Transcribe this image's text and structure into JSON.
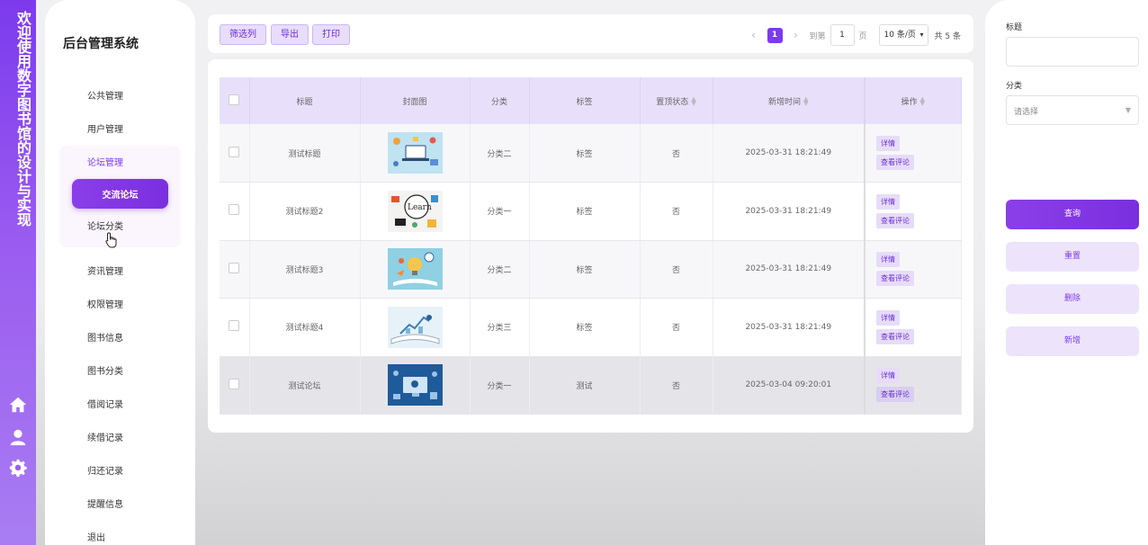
{
  "app": {
    "vertical_title": "欢迎使用数字图书馆的设计与实现",
    "brand": "后台管理系统"
  },
  "rail_icons": [
    "home-icon",
    "user-icon",
    "gear-icon"
  ],
  "menu": {
    "items": [
      "公共管理",
      "用户管理",
      "论坛管理",
      "资讯管理",
      "权限管理",
      "图书信息",
      "图书分类",
      "借阅记录",
      "续借记录",
      "归还记录",
      "提醒信息",
      "退出"
    ],
    "sub_items": [
      "交流论坛",
      "论坛分类"
    ],
    "active_parent": "论坛管理",
    "active_sub": "交流论坛"
  },
  "toolbar": {
    "filter_label": "筛选列",
    "export_label": "导出",
    "print_label": "打印"
  },
  "pagination": {
    "prev": "‹",
    "current_page": "1",
    "next": "›",
    "goto_label": "到第",
    "goto_value": "1",
    "page_unit": "页",
    "page_size": "10 条/页",
    "total": "共 5 条"
  },
  "table": {
    "columns": [
      "标题",
      "封面图",
      "分类",
      "标签",
      "置顶状态",
      "新增时间",
      "操作"
    ],
    "rows": [
      {
        "title": "测试标题",
        "category": "分类二",
        "tag": "标签",
        "pinned": "否",
        "created": "2025-03-31 18:21:49",
        "cover": "cover-illustration-laptop"
      },
      {
        "title": "测试标题2",
        "category": "分类一",
        "tag": "标签",
        "pinned": "否",
        "created": "2025-03-31 18:21:49",
        "cover": "cover-illustration-learn"
      },
      {
        "title": "测试标题3",
        "category": "分类二",
        "tag": "标签",
        "pinned": "否",
        "created": "2025-03-31 18:21:49",
        "cover": "cover-illustration-book-lightbulb"
      },
      {
        "title": "测试标题4",
        "category": "分类三",
        "tag": "标签",
        "pinned": "否",
        "created": "2025-03-31 18:21:49",
        "cover": "cover-illustration-open-book"
      },
      {
        "title": "测试论坛",
        "category": "分类一",
        "tag": "测试",
        "pinned": "否",
        "created": "2025-03-04 09:20:01",
        "cover": "cover-illustration-tech"
      }
    ],
    "row_actions": [
      "详情",
      "查看评论"
    ]
  },
  "search_panel": {
    "title_label": "标题",
    "title_value": "",
    "category_label": "分类",
    "category_placeholder": "请选择",
    "query_button": "查询",
    "reset_button": "重置",
    "delete_button": "删除",
    "add_button": "新增"
  },
  "colors": {
    "accent": "#7c3aed",
    "accent_light": "#e8e0fb",
    "button_light": "#ede4fb"
  }
}
